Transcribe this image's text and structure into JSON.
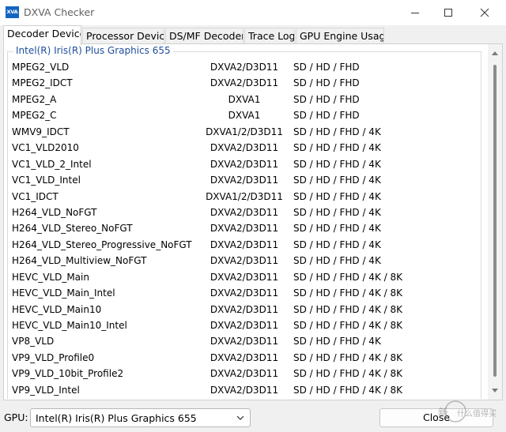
{
  "window": {
    "app_icon_text": "XVA",
    "title": "DXVA Checker"
  },
  "tabs": [
    {
      "label": "Decoder Device"
    },
    {
      "label": "Processor Device"
    },
    {
      "label": "DS/MF Decoder"
    },
    {
      "label": "Trace Log"
    },
    {
      "label": "GPU Engine Usage"
    }
  ],
  "group": {
    "title": "Intel(R) Iris(R) Plus Graphics 655"
  },
  "decoders": [
    {
      "name": "MPEG2_VLD",
      "api": "DXVA2/D3D11",
      "res": "SD / HD / FHD"
    },
    {
      "name": "MPEG2_IDCT",
      "api": "DXVA2/D3D11",
      "res": "SD / HD / FHD"
    },
    {
      "name": "MPEG2_A",
      "api": "DXVA1",
      "res": "SD / HD / FHD"
    },
    {
      "name": "MPEG2_C",
      "api": "DXVA1",
      "res": "SD / HD / FHD"
    },
    {
      "name": "WMV9_IDCT",
      "api": "DXVA1/2/D3D11",
      "res": "SD / HD / FHD / 4K"
    },
    {
      "name": "VC1_VLD2010",
      "api": "DXVA2/D3D11",
      "res": "SD / HD / FHD / 4K"
    },
    {
      "name": "VC1_VLD_2_Intel",
      "api": "DXVA2/D3D11",
      "res": "SD / HD / FHD / 4K"
    },
    {
      "name": "VC1_VLD_Intel",
      "api": "DXVA2/D3D11",
      "res": "SD / HD / FHD / 4K"
    },
    {
      "name": "VC1_IDCT",
      "api": "DXVA1/2/D3D11",
      "res": "SD / HD / FHD / 4K"
    },
    {
      "name": "H264_VLD_NoFGT",
      "api": "DXVA2/D3D11",
      "res": "SD / HD / FHD / 4K"
    },
    {
      "name": "H264_VLD_Stereo_NoFGT",
      "api": "DXVA2/D3D11",
      "res": "SD / HD / FHD / 4K"
    },
    {
      "name": "H264_VLD_Stereo_Progressive_NoFGT",
      "api": "DXVA2/D3D11",
      "res": "SD / HD / FHD / 4K"
    },
    {
      "name": "H264_VLD_Multiview_NoFGT",
      "api": "DXVA2/D3D11",
      "res": "SD / HD / FHD / 4K"
    },
    {
      "name": "HEVC_VLD_Main",
      "api": "DXVA2/D3D11",
      "res": "SD / HD / FHD / 4K / 8K"
    },
    {
      "name": "HEVC_VLD_Main_Intel",
      "api": "DXVA2/D3D11",
      "res": "SD / HD / FHD / 4K / 8K"
    },
    {
      "name": "HEVC_VLD_Main10",
      "api": "DXVA2/D3D11",
      "res": "SD / HD / FHD / 4K / 8K"
    },
    {
      "name": "HEVC_VLD_Main10_Intel",
      "api": "DXVA2/D3D11",
      "res": "SD / HD / FHD / 4K / 8K"
    },
    {
      "name": "VP8_VLD",
      "api": "DXVA2/D3D11",
      "res": "SD / HD / FHD / 4K"
    },
    {
      "name": "VP9_VLD_Profile0",
      "api": "DXVA2/D3D11",
      "res": "SD / HD / FHD / 4K / 8K"
    },
    {
      "name": "VP9_VLD_10bit_Profile2",
      "api": "DXVA2/D3D11",
      "res": "SD / HD / FHD / 4K / 8K"
    },
    {
      "name": "VP9_VLD_Intel",
      "api": "DXVA2/D3D11",
      "res": "SD / HD / FHD / 4K / 8K"
    }
  ],
  "footer": {
    "gpu_label": "GPU:",
    "gpu_value": "Intel(R) Iris(R) Plus Graphics 655",
    "close_label": "Close"
  },
  "watermark": {
    "text": "新 什么值得买"
  },
  "colors": {
    "accent": "#1565c0",
    "group_title": "#1f4e9c"
  }
}
